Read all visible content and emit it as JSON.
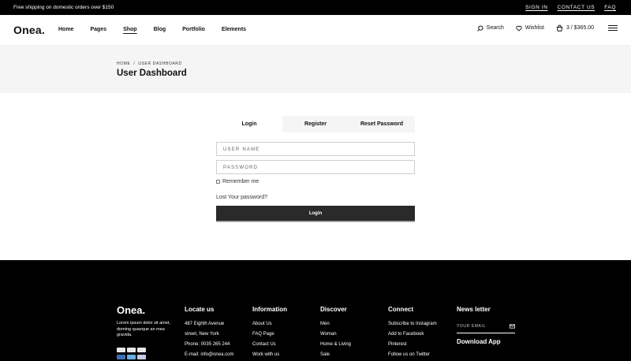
{
  "topbar": {
    "promo": "Free shipping on domestic orders over $150",
    "links": [
      "SIGN IN",
      "CONTACT US",
      "FAQ"
    ]
  },
  "header": {
    "logo": "Onea.",
    "nav": [
      "Home",
      "Pages",
      "Shop",
      "Blog",
      "Portfolio",
      "Elements"
    ],
    "active_nav": "Shop",
    "search_label": "Search",
    "wishlist_label": "Wishlist",
    "cart_label": "3 / $365.00"
  },
  "titleband": {
    "breadcrumb": [
      "HOME",
      "/",
      "USER DASHBOARD"
    ],
    "title": "User Dashboard"
  },
  "tabs": [
    "Login",
    "Register",
    "Reset Password"
  ],
  "form": {
    "username_placeholder": "USER NAME",
    "password_placeholder": "PASSWORD",
    "remember_label": "Remember me",
    "lost_password": "Lost Your password?",
    "login_button": "Login"
  },
  "footer": {
    "logo": "Onea.",
    "description": "Lorem ipsum dolor sit amet, doming quaeque an mea gravida.",
    "columns": [
      {
        "heading": "Locate us",
        "items": [
          "487 Eighth Avenue",
          "street, New York",
          "Phone: 0035 265 244",
          "E-mail: info@onea.com"
        ]
      },
      {
        "heading": "Information",
        "items": [
          "About Us",
          "FAQ Page",
          "Contact Us",
          "Work with us"
        ]
      },
      {
        "heading": "Discover",
        "items": [
          "Men",
          "Woman",
          "Home & Living",
          "Sale"
        ]
      },
      {
        "heading": "Connect",
        "items": [
          "Subscribe to Instagram",
          "Add to Facebook",
          "Pinterest",
          "Follow us on Twitter"
        ]
      }
    ],
    "newsletter": {
      "heading": "News letter",
      "email_placeholder": "YOUR EMAIL",
      "download": "Download App"
    }
  }
}
